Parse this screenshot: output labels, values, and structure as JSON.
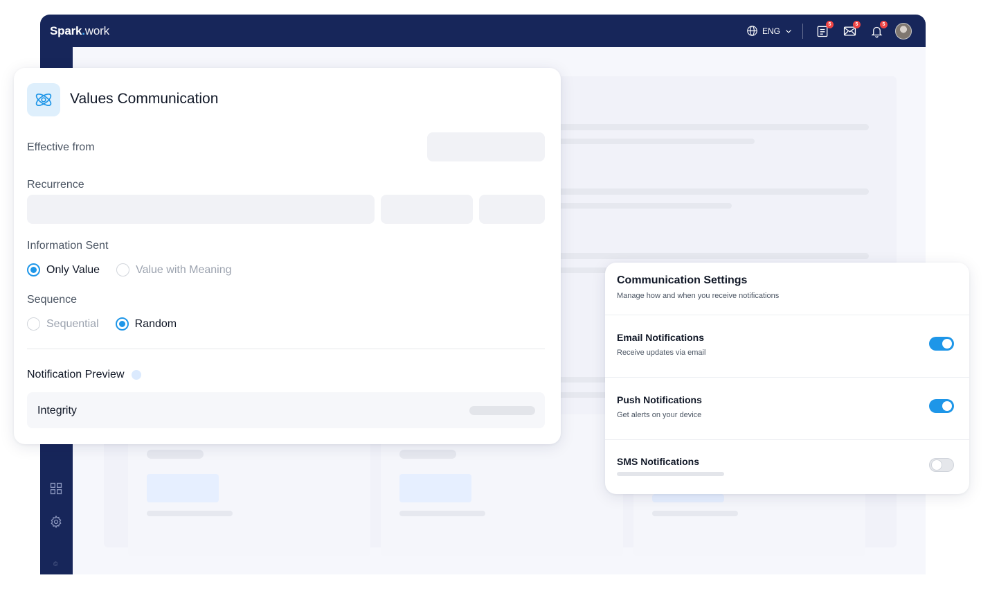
{
  "app": {
    "logo_brand": "Spark",
    "logo_dot": ".",
    "logo_tld": "work",
    "language": "ENG",
    "badges": {
      "tasks": "5",
      "messages": "5",
      "notifications": "5"
    },
    "icons": [
      "globe-icon",
      "chevron-down-icon",
      "tasks-icon",
      "mail-icon",
      "bell-icon",
      "dashboard-icon",
      "gear-icon"
    ]
  },
  "values_card": {
    "title": "Values Communication",
    "effective_from_label": "Effective from",
    "recurrence_label": "Recurrence",
    "information_sent": {
      "label": "Information Sent",
      "options": [
        "Only Value",
        "Value with Meaning"
      ],
      "selected": "Only Value"
    },
    "sequence": {
      "label": "Sequence",
      "options": [
        "Sequential",
        "Random"
      ],
      "selected": "Random"
    },
    "preview": {
      "label": "Notification Preview",
      "item": "Integrity"
    }
  },
  "settings_card": {
    "title": "Communication Settings",
    "subtitle": "Manage how and when you receive notifications",
    "rows": [
      {
        "title": "Email Notifications",
        "subtitle": "Receive updates via email",
        "enabled": true
      },
      {
        "title": "Push Notifications",
        "subtitle": "Get alerts on your device",
        "enabled": true
      },
      {
        "title": "SMS Notifications",
        "subtitle": "",
        "enabled": false
      }
    ]
  },
  "colors": {
    "navy": "#17265a",
    "accent": "#1e96e8",
    "badge": "#ef4444"
  }
}
